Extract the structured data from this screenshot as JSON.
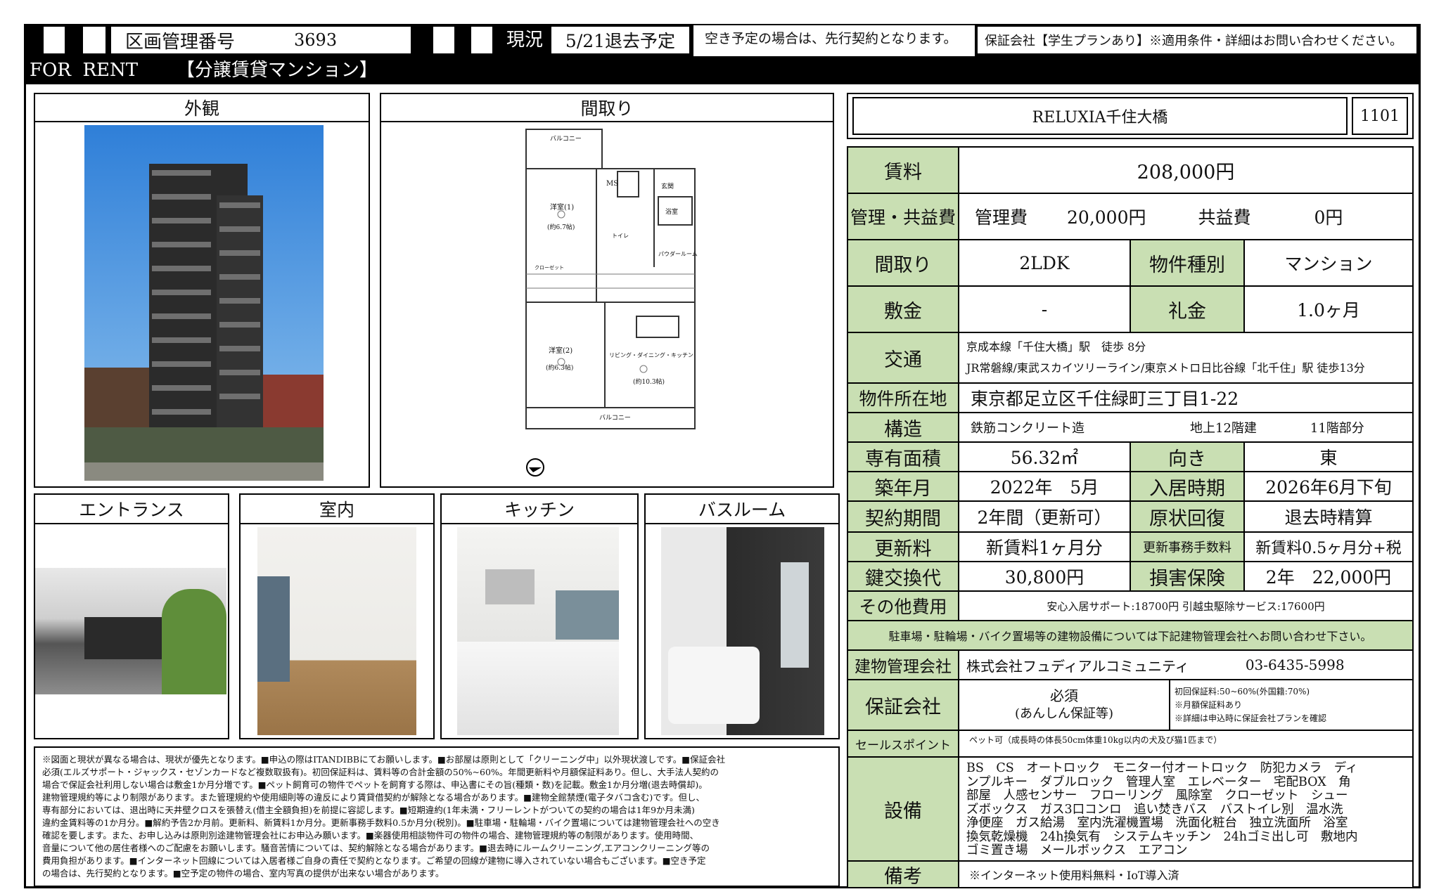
{
  "header": {
    "kukaku_label": "区画管理番号",
    "kukaku_no": "3693",
    "genkyo_label": "現況",
    "genkyo_value": "5/21退去予定",
    "vacancy_note": "空き予定の場合は、先行契約となります。",
    "guarantee_note": "保証会社【学生プランあり】※適用条件・詳細はお問い合わせください。",
    "for_rent": "FOR  RENT",
    "type": "【分譲賃貸マンション】"
  },
  "panels": {
    "exterior": "外観",
    "floorplan": "間取り",
    "entrance": "エントランス",
    "interior": "室内",
    "kitchen": "キッチン",
    "bathroom": "バスルーム"
  },
  "floorplan_labels": {
    "balcony_top": "バルコニー",
    "ms": "MS",
    "room1": "洋室(1)",
    "room1_size": "(約6.7帖)",
    "room2": "洋室(2)",
    "room2_size": "(約6.3帖)",
    "ldk": "リビング・ダイニング・キッチン",
    "ldk_size": "(約10.3帖)",
    "bath": "浴室",
    "powder": "パウダールーム",
    "toilet": "トイレ",
    "entry": "玄関",
    "closet": "クローゼット",
    "balcony_bottom": "バルコニー"
  },
  "property": {
    "name": "RELUXIA千住大橋",
    "room": "1101"
  },
  "rows": {
    "rent_label": "賃料",
    "rent": "208,000円",
    "mgmt_label": "管理・共益費",
    "mgmt_fee_label": "管理費",
    "mgmt_fee": "20,000円",
    "common_label": "共益費",
    "common_fee": "0円",
    "layout_label": "間取り",
    "layout": "2LDK",
    "kind_label": "物件種別",
    "kind": "マンション",
    "deposit_label": "敷金",
    "deposit": "-",
    "keymoney_label": "礼金",
    "keymoney": "1.0ヶ月",
    "access_label": "交通",
    "access1": "京成本線「千住大橋」駅　徒歩 8分",
    "access2": "JR常磐線/東武スカイツリーライン/東京メトロ日比谷線「北千住」駅 徒歩13分",
    "address_label": "物件所在地",
    "address": "東京都足立区千住緑町三丁目1-22",
    "structure_label": "構造",
    "structure": "鉄筋コンクリート造",
    "floors": "地上12階建",
    "floor_part": "11階部分",
    "area_label": "専有面積",
    "area": "56.32㎡",
    "direction_label": "向き",
    "direction": "東",
    "built_label": "築年月",
    "built": "2022年　5月",
    "movein_label": "入居時期",
    "movein": "2026年6月下旬",
    "term_label": "契約期間",
    "term": "2年間（更新可）",
    "restore_label": "原状回復",
    "restore": "退去時精算",
    "renew_label": "更新料",
    "renew": "新賃料1ヶ月分",
    "renew_fee_label": "更新事務手数料",
    "renew_fee": "新賃料0.5ヶ月分+税",
    "key_label": "鍵交換代",
    "key": "30,800円",
    "insurance_label": "損害保険",
    "insurance": "2年　22,000円",
    "other_label": "その他費用",
    "other": "安心入居サポート:18700円 引越虫駆除サービス:17600円",
    "parking_note": "駐車場・駐輪場・バイク置場等の建物設備については下記建物管理会社へお問い合わせ下さい。",
    "bldg_mgmt_label": "建物管理会社",
    "bldg_mgmt": "株式会社フュディアルコミュニティ",
    "bldg_mgmt_tel": "03-6435-5998",
    "guarantor_label": "保証会社",
    "guarantor_req": "必須",
    "guarantor_sub": "(あんしん保証等)",
    "guarantor_note1": "初回保証料:50~60%(外国籍:70%)",
    "guarantor_note2": "※月額保証料あり",
    "guarantor_note3": "※詳細は申込時に保証会社プランを確認",
    "sales_label": "セールスポイント",
    "sales": "ペット可（成長時の体長50cm体重10kg以内の犬及び猫1匹まで）",
    "equip_label": "設備",
    "equip_lines": [
      "BS　CS　オートロック　モニター付オートロック　防犯カメラ　ディ",
      "ンプルキー　ダブルロック　管理人室　エレベーター　宅配BOX　角",
      "部屋　人感センサー　フローリング　風除室　クローゼット　シュー",
      "ズボックス　ガス3口コンロ　追い焚きバス　バストイレ別　温水洗",
      "浄便座　ガス給湯　室内洗濯機置場　洗面化粧台　独立洗面所　浴室",
      "換気乾燥機　24h換気有　システムキッチン　24hゴミ出し可　敷地内",
      "ゴミ置き場　メールボックス　エアコン"
    ],
    "remarks_label": "備考",
    "remarks": "※インターネット使用料無料・IoT導入済"
  },
  "disclaimer_lines": [
    "※図面と現状が異なる場合は、現状が優先となります。■申込の際はITANDIBBにてお願いします。■お部屋は原則として「クリーニング中」以外現状渡しです。■保証会社",
    "必須(エルズサポート・ジャックス・セゾンカードなど複数取扱有)。初回保証料は、賃料等の合計金額の50%~60%。年間更新料や月額保証料あり。但し、大手法人契約の",
    "場合で保証会社利用しない場合は敷金1か月分増です。■ペット飼育可の物件でペットを飼育する際は、申込書にその旨(種類・数)を記載。敷金1か月分増(退去時償却)。",
    "建物管理規約等により制限があります。また管理規約や使用細則等の違反により賃貸借契約が解除となる場合があります。■建物全館禁煙(電子タバコ含む)です。但し、",
    "専有部分においては、退出時に天井壁クロスを張替え(借主全額負担)を前提に容認します。■短期違約(1年未満・フリーレントがついての契約の場合は1年9か月未満)",
    "違約金賃料等の1か月分。■解約予告2か月前。更新料、新賃料1か月分。更新事務手数料0.5か月分(税別)。■駐車場・駐輪場・バイク置場については建物管理会社への空き",
    "確認を要します。また、お申し込みは原則別途建物管理会社にお申込み願います。■楽器使用相談物件可の物件の場合、建物管理規約等の制限があります。使用時間、",
    "音量について他の居住者様へのご配慮をお願いします。騒音苦情については、契約解除となる場合があります。■退去時にルームクリーニング,エアコンクリーニング等の",
    "費用負担があります。■インターネット回線については入居者様ご自身の責任で契約となります。ご希望の回線が建物に導入されていない場合もございます。■空き予定",
    "の場合は、先行契約となります。■空予定の物件の場合、室内写真の提供が出来ない場合があります。"
  ],
  "colors": {
    "label_green": "#c9dfb3",
    "black": "#000000"
  }
}
